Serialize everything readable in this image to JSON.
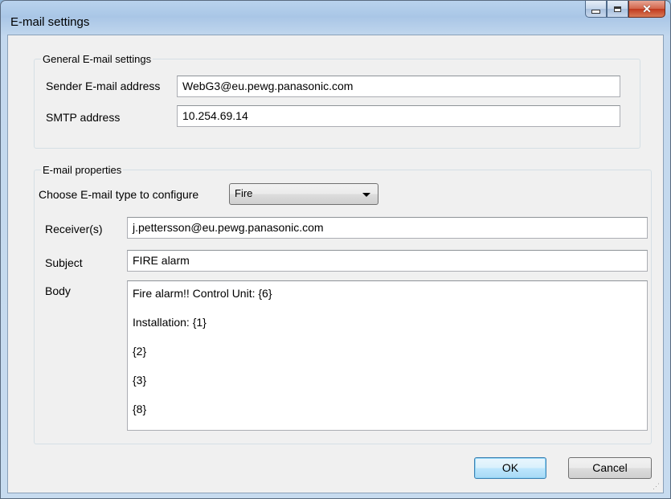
{
  "window": {
    "title": "E-mail settings"
  },
  "general": {
    "legend": "General E-mail settings",
    "sender_label": "Sender E-mail address",
    "sender_value": "WebG3@eu.pewg.panasonic.com",
    "smtp_label": "SMTP address",
    "smtp_value": "10.254.69.14"
  },
  "properties": {
    "legend": "E-mail properties",
    "type_label": "Choose E-mail type to configure",
    "type_selected": "Fire",
    "receivers_label": "Receiver(s)",
    "receivers_value": "j.pettersson@eu.pewg.panasonic.com",
    "subject_label": "Subject",
    "subject_value": "FIRE alarm",
    "body_label": "Body",
    "body_lines": [
      "Fire alarm!!  Control Unit:  {6}",
      "Installation:  {1}",
      "{2}",
      "{3}",
      "{8}"
    ]
  },
  "buttons": {
    "ok": "OK",
    "cancel": "Cancel"
  },
  "icons": {
    "minimize": "minimize-icon",
    "maximize": "maximize-icon",
    "close": "close-icon",
    "dropdown": "chevron-down-icon",
    "grip": "resize-grip-icon"
  }
}
